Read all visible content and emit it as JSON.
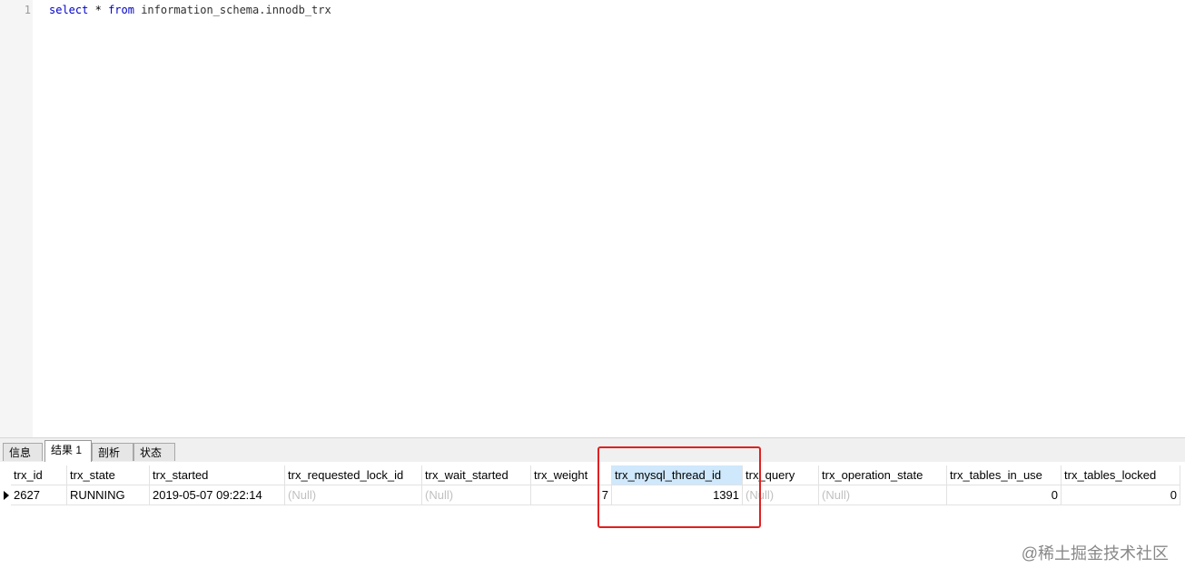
{
  "editor": {
    "line_number": "1",
    "query": {
      "kw_select": "select",
      "star": "*",
      "kw_from": "from",
      "table": "information_schema.innodb_trx"
    }
  },
  "tabs": [
    {
      "label": "信息"
    },
    {
      "label": "结果 1"
    },
    {
      "label": "剖析"
    },
    {
      "label": "状态"
    }
  ],
  "grid": {
    "columns": [
      "trx_id",
      "trx_state",
      "trx_started",
      "trx_requested_lock_id",
      "trx_wait_started",
      "trx_weight",
      "trx_mysql_thread_id",
      "trx_query",
      "trx_operation_state",
      "trx_tables_in_use",
      "trx_tables_locked"
    ],
    "row": [
      "2627",
      "RUNNING",
      "2019-05-07 09:22:14",
      "(Null)",
      "(Null)",
      "7",
      "1391",
      "(Null)",
      "(Null)",
      "0",
      "0"
    ]
  },
  "watermark": "@稀土掘金技术社区"
}
